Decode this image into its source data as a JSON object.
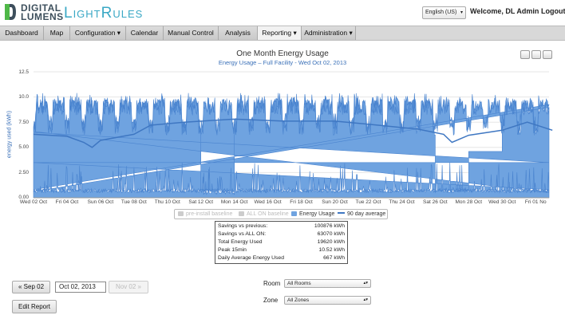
{
  "brand": {
    "logo_line1": "DIGITAL",
    "logo_line2": "LUMENS",
    "app_name": "LightRules",
    "accent_color": "#3aa8c5"
  },
  "header": {
    "language": "English (US)",
    "welcome": "Welcome, DL Admin",
    "logout": "Logout"
  },
  "nav": {
    "items": [
      {
        "label": "Dashboard"
      },
      {
        "label": "Map"
      },
      {
        "label": "Configuration ▾"
      },
      {
        "label": "Calendar"
      },
      {
        "label": "Manual Control"
      },
      {
        "label": "Analysis"
      },
      {
        "label": "Reporting ▾"
      },
      {
        "label": "Administration ▾"
      }
    ],
    "active": "Reporting"
  },
  "chart": {
    "title": "One Month Energy Usage",
    "subtitle": "Energy Usage – Full Facility - Wed Oct 02, 2013",
    "ylabel": "energy used (kWh)",
    "yticks": [
      "0.00",
      "2.50",
      "5.00",
      "7.50",
      "10.0",
      "12.5"
    ],
    "xticks": [
      "Wed 02 Oct",
      "Fri 04 Oct",
      "Sun 06 Oct",
      "Tue 08 Oct",
      "Thu 10 Oct",
      "Sat 12 Oct",
      "Mon 14 Oct",
      "Wed 16 Oct",
      "Fri 18 Oct",
      "Sun 20 Oct",
      "Tue 22 Oct",
      "Thu 24 Oct",
      "Sat 26 Oct",
      "Mon 28 Oct",
      "Wed 30 Oct",
      "Fri 01 No"
    ],
    "legend": {
      "preinstall": "pre-install baseline",
      "allon": "ALL ON baseline",
      "energy": "Energy Usage",
      "avg": "90 day average"
    },
    "colors": {
      "energy_fill": "#6fa3e0",
      "energy_stroke": "#4a84cf",
      "avg_line": "#3f77c2",
      "grid": "#e6e6e6",
      "disabled": "#c8c8c8"
    }
  },
  "chart_data": {
    "type": "area",
    "title": "One Month Energy Usage",
    "subtitle": "Energy Usage – Full Facility - Wed Oct 02, 2013",
    "ylabel": "energy used (kWh)",
    "ylim": [
      0,
      12.5
    ],
    "xlim_days": [
      "Wed 02 Oct",
      "Fri 01 No"
    ],
    "series": [
      {
        "name": "Energy Usage",
        "segments": [
          {
            "from": "Wed 02 Oct",
            "to": "Sat 05 Oct",
            "level": 9.8,
            "pattern": "weekday-daily-peaks"
          },
          {
            "from": "Sat 05 Oct",
            "to": "Mon 07 Oct",
            "level": 0.5,
            "pattern": "low-with-spikes"
          },
          {
            "from": "Mon 07 Oct",
            "to": "Wed 09 Oct",
            "level": 3.5,
            "pattern": "flat"
          },
          {
            "from": "Wed 09 Oct",
            "to": "Sat 12 Oct",
            "level": 9.8,
            "pattern": "weekday-daily-peaks"
          },
          {
            "from": "Sat 12 Oct",
            "to": "Mon 14 Oct",
            "level": 0.3,
            "pattern": "low-with-spikes"
          },
          {
            "from": "Mon 14 Oct",
            "to": "Sat 19 Oct",
            "level": 9.8,
            "pattern": "weekday-daily-peaks"
          },
          {
            "from": "Sat 19 Oct",
            "to": "Mon 21 Oct",
            "level": 0.5,
            "pattern": "low-with-spikes"
          },
          {
            "from": "Mon 21 Oct",
            "to": "Sat 26 Oct",
            "level": 9.8,
            "pattern": "weekday-daily-peaks"
          },
          {
            "from": "Sat 26 Oct",
            "to": "Mon 28 Oct",
            "level": 0.6,
            "pattern": "low-with-spikes"
          },
          {
            "from": "Mon 28 Oct",
            "to": "Wed 30 Oct",
            "level": 4.6,
            "pattern": "flat"
          },
          {
            "from": "Wed 30 Oct",
            "to": "Fri 01 No",
            "level": 9.8,
            "pattern": "weekday-daily-peaks"
          }
        ]
      },
      {
        "name": "90 day average",
        "points": [
          [
            0,
            6.3
          ],
          [
            2,
            6.1
          ],
          [
            3,
            5.5
          ],
          [
            3.5,
            5.0
          ],
          [
            4,
            5.7
          ],
          [
            6,
            6.3
          ],
          [
            7,
            7.2
          ],
          [
            9,
            7.5
          ],
          [
            12,
            7.8
          ],
          [
            15,
            7.6
          ],
          [
            18,
            7.6
          ],
          [
            20,
            7.3
          ],
          [
            23,
            6.8
          ],
          [
            24.5,
            6.3
          ],
          [
            25,
            5.5
          ],
          [
            26,
            6.2
          ],
          [
            28,
            6.7
          ],
          [
            29.5,
            7.5
          ],
          [
            31,
            6.7
          ]
        ]
      }
    ],
    "legend": [
      "pre-install baseline",
      "ALL ON baseline",
      "Energy Usage",
      "90 day average"
    ],
    "legend_position": "bottom-center",
    "grid": true
  },
  "stats": [
    {
      "label": "Savings vs previous:",
      "value": "100876",
      "unit": "kWh"
    },
    {
      "label": "Savings vs ALL ON:",
      "value": "63070",
      "unit": "kWh"
    },
    {
      "label": "Total Energy Used",
      "value": "19620",
      "unit": "kWh"
    },
    {
      "label": "Peak 15min",
      "value": "10.52",
      "unit": "kWh"
    },
    {
      "label": "Daily Average Energy Used",
      "value": "667",
      "unit": "kWh"
    }
  ],
  "controls": {
    "prev": "« Sep 02",
    "date": "Oct 02, 2013",
    "next": "Nov 02 »",
    "edit": "Edit Report",
    "room_label": "Room",
    "room_value": "All Rooms",
    "zone_label": "Zone",
    "zone_value": "All Zones"
  }
}
